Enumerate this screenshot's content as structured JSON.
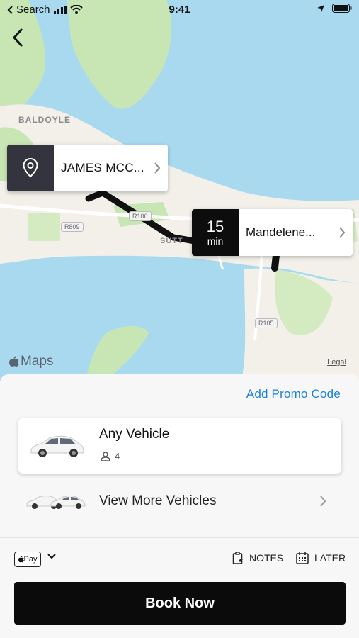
{
  "status_bar": {
    "back_app_label": "Search",
    "time": "9:41"
  },
  "map": {
    "place_label": "BALDOYLE",
    "road_labels": [
      "R106",
      "R809",
      "R105"
    ],
    "partial_label": "SUTT",
    "attribution": "Maps",
    "legal": "Legal",
    "pickup": {
      "address": "JAMES MCC..."
    },
    "dropoff": {
      "eta_value": "15",
      "eta_unit": "min",
      "address": "Mandelene..."
    }
  },
  "sheet": {
    "promo_label": "Add Promo Code",
    "selected_vehicle": {
      "name": "Any Vehicle",
      "seats": "4"
    },
    "more_vehicles_label": "View More Vehicles",
    "payment": {
      "method_label": "Pay"
    },
    "notes_label": "NOTES",
    "later_label": "LATER",
    "book_label": "Book Now"
  },
  "colors": {
    "accent_link": "#1a7fd8",
    "primary_button": "#0b0b0b",
    "pickup_badge": "#34343e",
    "water": "#a8d9ef",
    "land": "#f2f0e9",
    "park": "#c8e6b4"
  },
  "icons": [
    "back-chevron-icon",
    "signal-icon",
    "wifi-icon",
    "location-arrow-icon",
    "battery-icon",
    "location-pin-icon",
    "chevron-right-icon",
    "apple-logo-icon",
    "person-icon",
    "chevron-down-icon",
    "notes-icon",
    "calendar-icon",
    "car-icon"
  ]
}
